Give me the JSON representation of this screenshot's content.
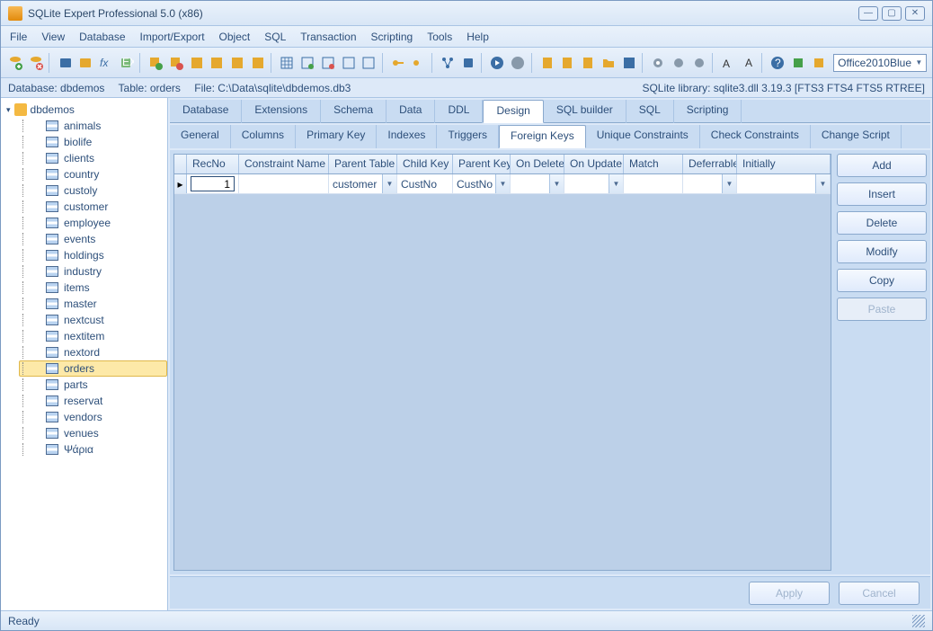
{
  "title": "SQLite Expert Professional 5.0 (x86)",
  "menu": [
    "File",
    "View",
    "Database",
    "Import/Export",
    "Object",
    "SQL",
    "Transaction",
    "Scripting",
    "Tools",
    "Help"
  ],
  "theme": "Office2010Blue",
  "info": {
    "database": "Database: dbdemos",
    "table": "Table: orders",
    "file": "File: C:\\Data\\sqlite\\dbdemos.db3",
    "lib": "SQLite library: sqlite3.dll 3.19.3 [FTS3 FTS4 FTS5 RTREE]"
  },
  "tree": {
    "root": "dbdemos",
    "tables": [
      "animals",
      "biolife",
      "clients",
      "country",
      "custoly",
      "customer",
      "employee",
      "events",
      "holdings",
      "industry",
      "items",
      "master",
      "nextcust",
      "nextitem",
      "nextord",
      "orders",
      "parts",
      "reservat",
      "vendors",
      "venues",
      "Ψάρια"
    ],
    "selected": "orders"
  },
  "tabs": {
    "main": [
      "Database",
      "Extensions",
      "Schema",
      "Data",
      "DDL",
      "Design",
      "SQL builder",
      "SQL",
      "Scripting"
    ],
    "main_active": "Design",
    "sub": [
      "General",
      "Columns",
      "Primary Key",
      "Indexes",
      "Triggers",
      "Foreign Keys",
      "Unique Constraints",
      "Check Constraints",
      "Change Script"
    ],
    "sub_active": "Foreign Keys"
  },
  "grid": {
    "headers": [
      "RecNo",
      "Constraint Name",
      "Parent Table",
      "Child Key",
      "Parent Key",
      "On Delete",
      "On Update",
      "Match",
      "Deferrable",
      "Initially"
    ],
    "row": {
      "recno": "1",
      "constraint": "",
      "parent_table": "customer",
      "child_key": "CustNo",
      "parent_key": "CustNo",
      "on_delete": "",
      "on_update": "",
      "match": "",
      "deferrable": "",
      "initially": ""
    }
  },
  "actions": [
    "Add",
    "Insert",
    "Delete",
    "Modify",
    "Copy",
    "Paste"
  ],
  "action_disabled": [
    "Paste"
  ],
  "bottom": {
    "apply": "Apply",
    "cancel": "Cancel"
  },
  "status": "Ready"
}
